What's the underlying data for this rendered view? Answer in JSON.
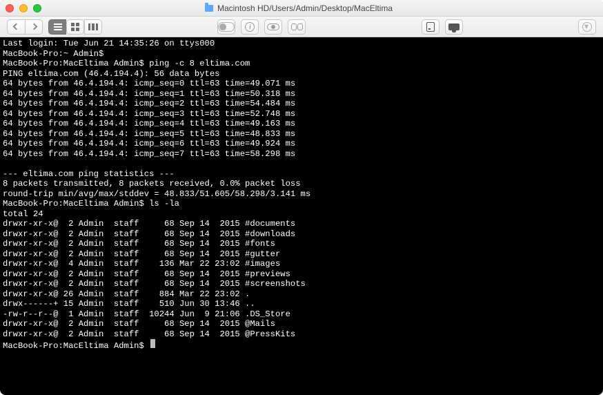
{
  "window": {
    "path": "Macintosh HD/Users/Admin/Desktop/MacEltima"
  },
  "session": {
    "last_login": "Last login: Tue Jun 21 14:35:26 on ttys000",
    "prompt_home": "MacBook-Pro:~ Admin$",
    "prompt_dir": "MacBook-Pro:MacEltima Admin$",
    "ping_cmd": "ping -c 8 eltima.com",
    "ping_header": "PING eltima.com (46.4.194.4): 56 data bytes",
    "ping_ip": "46.4.194.4",
    "ping_ttl": 63,
    "ping_lines": [
      {
        "seq": 0,
        "time": "49.071"
      },
      {
        "seq": 1,
        "time": "50.318"
      },
      {
        "seq": 2,
        "time": "54.484"
      },
      {
        "seq": 3,
        "time": "52.748"
      },
      {
        "seq": 4,
        "time": "49.163"
      },
      {
        "seq": 5,
        "time": "48.833"
      },
      {
        "seq": 6,
        "time": "49.924"
      },
      {
        "seq": 7,
        "time": "58.298"
      }
    ],
    "stats_header": "--- eltima.com ping statistics ---",
    "stats_line1": "8 packets transmitted, 8 packets received, 0.0% packet loss",
    "stats_line2": "round-trip min/avg/max/stddev = 48.833/51.605/58.298/3.141 ms",
    "ls_cmd": "ls -la",
    "ls_total": "total 24",
    "ls_rows": [
      {
        "perm": "drwxr-xr-x@",
        "links": " 2",
        "owner": "Admin",
        "group": "staff",
        "size": "    68",
        "date": "Sep 14  2015",
        "name": "#documents"
      },
      {
        "perm": "drwxr-xr-x@",
        "links": " 2",
        "owner": "Admin",
        "group": "staff",
        "size": "    68",
        "date": "Sep 14  2015",
        "name": "#downloads"
      },
      {
        "perm": "drwxr-xr-x@",
        "links": " 2",
        "owner": "Admin",
        "group": "staff",
        "size": "    68",
        "date": "Sep 14  2015",
        "name": "#fonts"
      },
      {
        "perm": "drwxr-xr-x@",
        "links": " 2",
        "owner": "Admin",
        "group": "staff",
        "size": "    68",
        "date": "Sep 14  2015",
        "name": "#gutter"
      },
      {
        "perm": "drwxr-xr-x@",
        "links": " 4",
        "owner": "Admin",
        "group": "staff",
        "size": "   136",
        "date": "Mar 22 23:02",
        "name": "#images"
      },
      {
        "perm": "drwxr-xr-x@",
        "links": " 2",
        "owner": "Admin",
        "group": "staff",
        "size": "    68",
        "date": "Sep 14  2015",
        "name": "#previews"
      },
      {
        "perm": "drwxr-xr-x@",
        "links": " 2",
        "owner": "Admin",
        "group": "staff",
        "size": "    68",
        "date": "Sep 14  2015",
        "name": "#screenshots"
      },
      {
        "perm": "drwxr-xr-x@",
        "links": "26",
        "owner": "Admin",
        "group": "staff",
        "size": "   884",
        "date": "Mar 22 23:02",
        "name": "."
      },
      {
        "perm": "drwx------+",
        "links": "15",
        "owner": "Admin",
        "group": "staff",
        "size": "   510",
        "date": "Jun 30 13:46",
        "name": ".."
      },
      {
        "perm": "-rw-r--r--@",
        "links": " 1",
        "owner": "Admin",
        "group": "staff",
        "size": " 10244",
        "date": "Jun  9 21:06",
        "name": ".DS_Store"
      },
      {
        "perm": "drwxr-xr-x@",
        "links": " 2",
        "owner": "Admin",
        "group": "staff",
        "size": "    68",
        "date": "Sep 14  2015",
        "name": "@Mails"
      },
      {
        "perm": "drwxr-xr-x@",
        "links": " 2",
        "owner": "Admin",
        "group": "staff",
        "size": "    68",
        "date": "Sep 14  2015",
        "name": "@PressKits"
      }
    ]
  }
}
